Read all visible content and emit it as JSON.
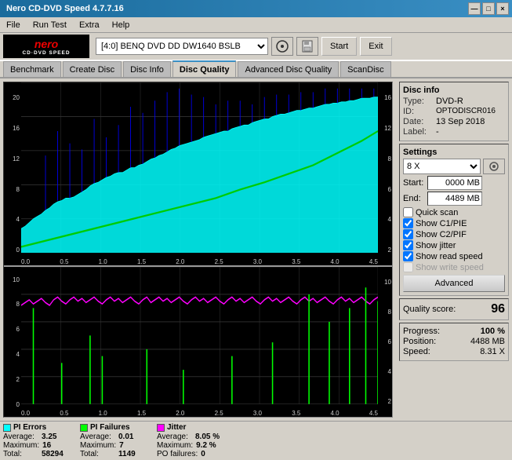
{
  "titlebar": {
    "title": "Nero CD-DVD Speed 4.7.7.16",
    "controls": [
      "—",
      "□",
      "×"
    ]
  },
  "menubar": {
    "items": [
      "File",
      "Run Test",
      "Extra",
      "Help"
    ]
  },
  "toolbar": {
    "logo_line1": "nero",
    "logo_line2": "CD·DVD SPEED",
    "drive_label": "[4:0]",
    "drive_name": "BENQ DVD DD DW1640 BSLB",
    "start_label": "Start",
    "exit_label": "Exit"
  },
  "tabs": [
    {
      "label": "Benchmark"
    },
    {
      "label": "Create Disc"
    },
    {
      "label": "Disc Info"
    },
    {
      "label": "Disc Quality",
      "active": true
    },
    {
      "label": "Advanced Disc Quality"
    },
    {
      "label": "ScanDisc"
    }
  ],
  "disc_info": {
    "section_title": "Disc info",
    "type_label": "Type:",
    "type_value": "DVD-R",
    "id_label": "ID:",
    "id_value": "OPTODISCR016",
    "date_label": "Date:",
    "date_value": "13 Sep 2018",
    "label_label": "Label:",
    "label_value": "-"
  },
  "settings": {
    "section_title": "Settings",
    "speed": "8 X",
    "start_label": "Start:",
    "start_value": "0000 MB",
    "end_label": "End:",
    "end_value": "4489 MB",
    "quick_scan": "Quick scan",
    "show_c1pie": "Show C1/PIE",
    "show_c2pif": "Show C2/PIF",
    "show_jitter": "Show jitter",
    "show_read_speed": "Show read speed",
    "show_write_speed": "Show write speed",
    "advanced_btn": "Advanced",
    "quick_scan_checked": true,
    "c1pie_checked": true,
    "c2pif_checked": true,
    "jitter_checked": true,
    "read_speed_checked": true,
    "write_speed_checked": false
  },
  "quality": {
    "score_label": "Quality score:",
    "score_value": "96"
  },
  "progress": {
    "progress_label": "Progress:",
    "progress_value": "100 %",
    "position_label": "Position:",
    "position_value": "4488 MB",
    "speed_label": "Speed:",
    "speed_value": "8.31 X"
  },
  "stats": {
    "pi_errors": {
      "label": "PI Errors",
      "color": "#00ffff",
      "avg_label": "Average:",
      "avg_value": "3.25",
      "max_label": "Maximum:",
      "max_value": "16",
      "total_label": "Total:",
      "total_value": "58294"
    },
    "pi_failures": {
      "label": "PI Failures",
      "color": "#00ff00",
      "avg_label": "Average:",
      "avg_value": "0.01",
      "max_label": "Maximum:",
      "max_value": "7",
      "total_label": "Total:",
      "total_value": "1149"
    },
    "jitter": {
      "label": "Jitter",
      "color": "#ff00ff",
      "avg_label": "Average:",
      "avg_value": "8.05 %",
      "max_label": "Maximum:",
      "max_value": "9.2 %"
    },
    "po_failures": {
      "label": "PO failures:",
      "value": "0"
    }
  },
  "chart1": {
    "y_labels_left": [
      "20",
      "16",
      "12",
      "8",
      "4",
      "0"
    ],
    "y_labels_right": [
      "16",
      "12",
      "8",
      "6",
      "4",
      "2"
    ],
    "x_labels": [
      "0.0",
      "0.5",
      "1.0",
      "1.5",
      "2.0",
      "2.5",
      "3.0",
      "3.5",
      "4.0",
      "4.5"
    ]
  },
  "chart2": {
    "y_labels_left": [
      "10",
      "8",
      "6",
      "4",
      "2",
      "0"
    ],
    "y_labels_right": [
      "10",
      "8",
      "6",
      "4",
      "2"
    ],
    "x_labels": [
      "0.0",
      "0.5",
      "1.0",
      "1.5",
      "2.0",
      "2.5",
      "3.0",
      "3.5",
      "4.0",
      "4.5"
    ]
  }
}
